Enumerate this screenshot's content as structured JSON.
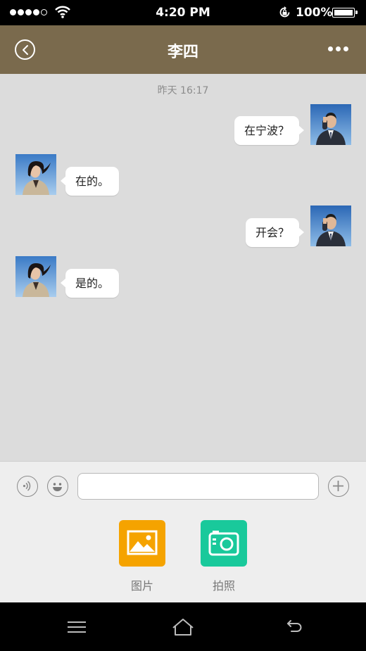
{
  "status_bar": {
    "time": "4:20 PM",
    "battery": "100%"
  },
  "header": {
    "title": "李四"
  },
  "chat": {
    "timestamp": "昨天  16:17",
    "messages": [
      {
        "side": "right",
        "sender": "self",
        "text": "在宁波？"
      },
      {
        "side": "left",
        "sender": "contact",
        "text": "在的。"
      },
      {
        "side": "right",
        "sender": "self",
        "text": "开会？"
      },
      {
        "side": "left",
        "sender": "contact",
        "text": "是的。"
      }
    ]
  },
  "input": {
    "value": "",
    "placeholder": ""
  },
  "tools": [
    {
      "label": "图片",
      "icon": "image-icon",
      "color": "#f5a300"
    },
    {
      "label": "拍照",
      "icon": "camera-icon",
      "color": "#19c99b"
    }
  ],
  "colors": {
    "header_bg": "#7a6a4d",
    "chat_bg": "#dcdcdc",
    "bubble_bg": "#ffffff"
  }
}
